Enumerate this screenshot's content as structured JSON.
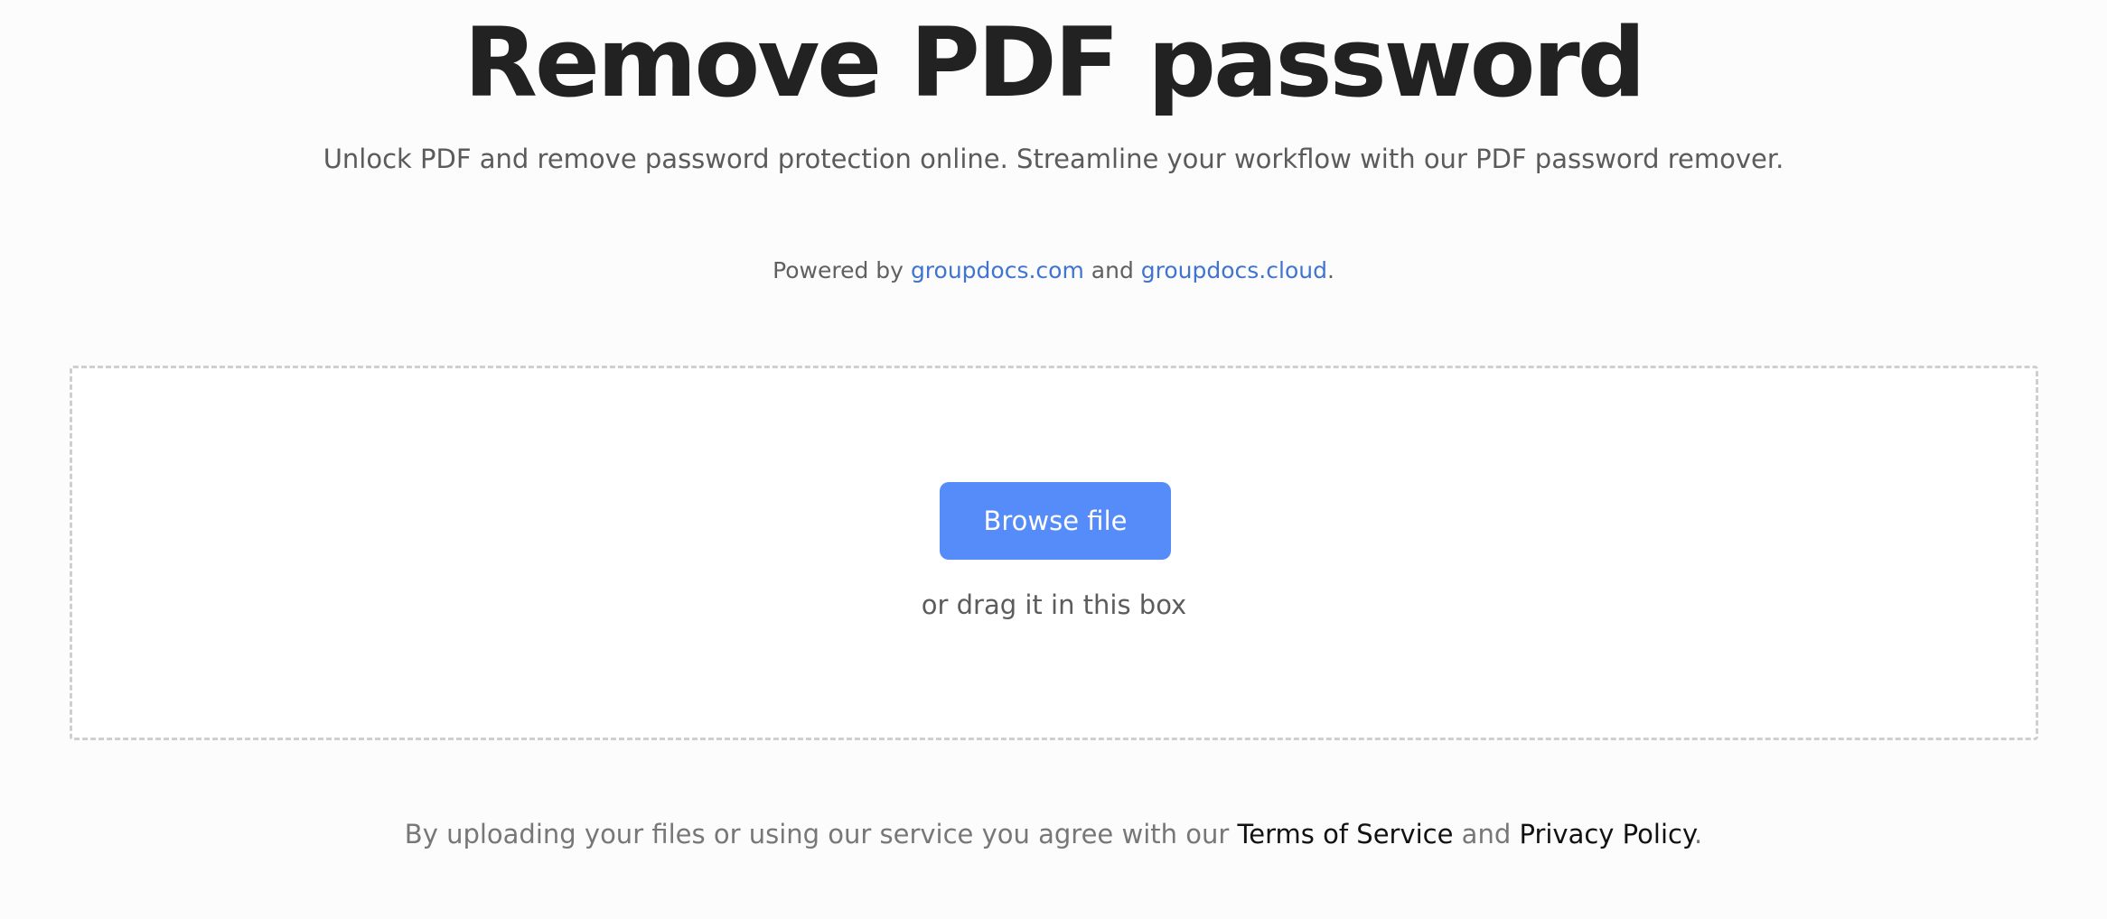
{
  "header": {
    "title": "Remove PDF password",
    "subtitle": "Unlock PDF and remove password protection online. Streamline your workflow with our PDF password remover."
  },
  "powered": {
    "prefix": "Powered by ",
    "link1": "groupdocs.com",
    "middle": " and ",
    "link2": "groupdocs.cloud",
    "suffix": "."
  },
  "upload": {
    "browse_label": "Browse file",
    "drag_hint": "or drag it in this box"
  },
  "legal": {
    "prefix": "By uploading your files or using our service you agree with our ",
    "terms_label": "Terms of Service",
    "middle": " and ",
    "privacy_label": "Privacy Policy",
    "suffix": "."
  },
  "colors": {
    "accent": "#568cfa",
    "link": "#3f74d1",
    "title": "#222222",
    "background": "#fcfcfc"
  }
}
